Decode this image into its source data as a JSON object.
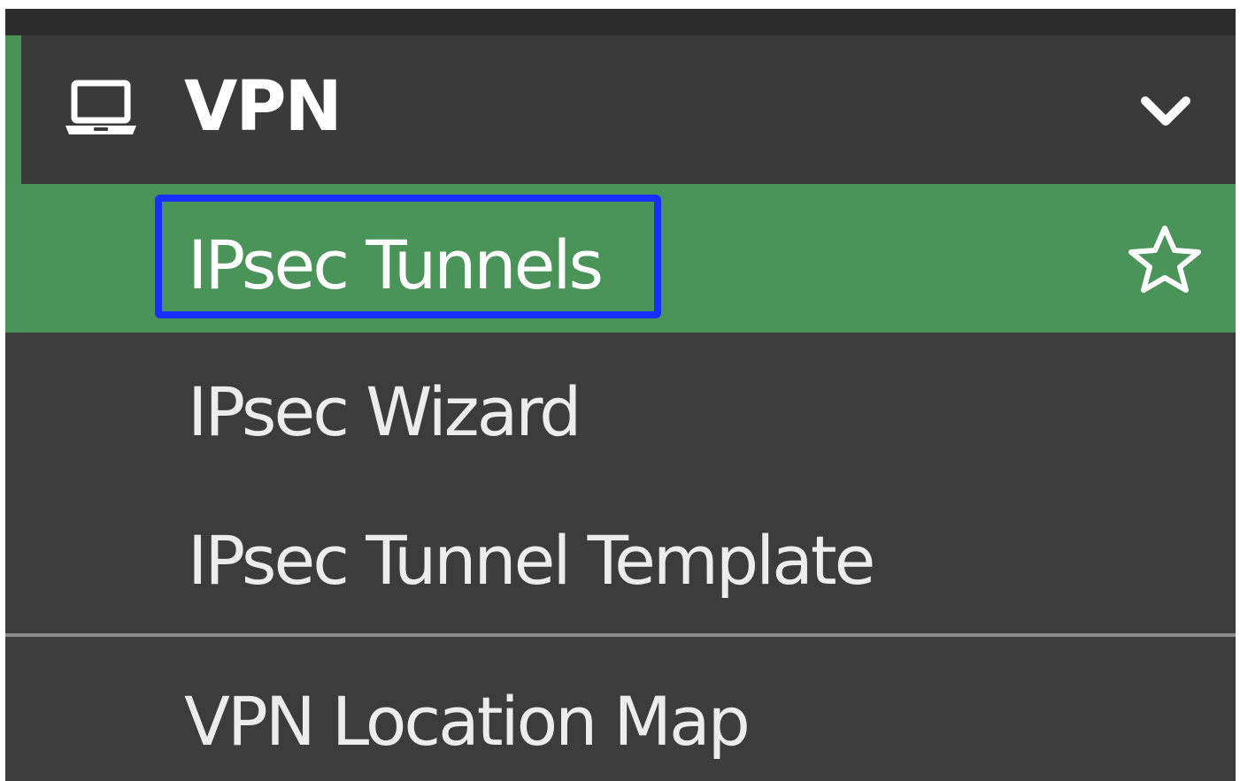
{
  "menu": {
    "section": {
      "title": "VPN",
      "icon": "laptop-icon",
      "toggle_icon": "chevron-down-icon"
    },
    "items": [
      {
        "label": "IPsec Tunnels",
        "active": true,
        "favorite_icon": "star-outline-icon"
      },
      {
        "label": "IPsec Wizard"
      },
      {
        "label": "IPsec Tunnel Template"
      },
      {
        "label": "VPN Location Map"
      }
    ]
  },
  "colors": {
    "panel": "#3c3c3c",
    "active_item": "#4b9459",
    "accent_bar": "#4a9156",
    "focus_outline": "#1830ff",
    "text": "#ffffff"
  }
}
